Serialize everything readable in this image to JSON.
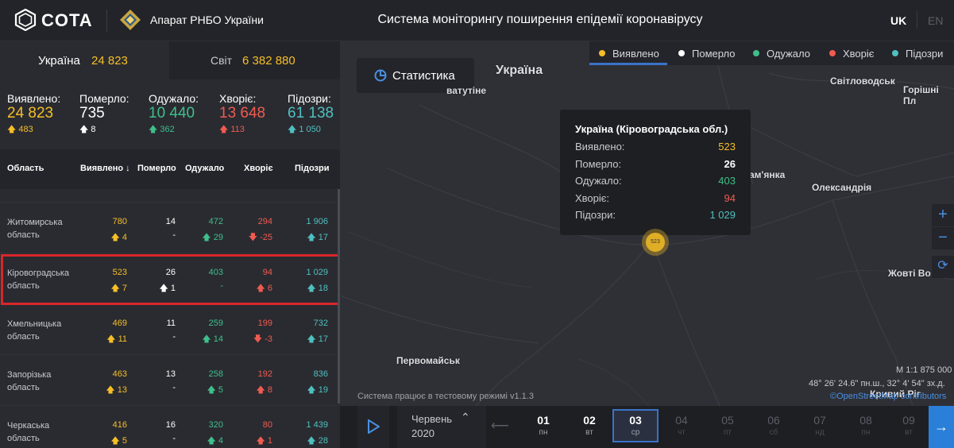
{
  "header": {
    "logo_text": "COTA",
    "org_name": "Апарат РНБО України",
    "title": "Система моніторингу поширення епідемії коронавірусу",
    "lang_uk": "UK",
    "lang_en": "EN"
  },
  "tabs": {
    "ukraine": {
      "label": "Україна",
      "value": "24 823"
    },
    "world": {
      "label": "Світ",
      "value": "6 382 880"
    }
  },
  "stats": [
    {
      "label": "Виявлено:",
      "value": "24 823",
      "delta": "483"
    },
    {
      "label": "Померло:",
      "value": "735",
      "delta": "8"
    },
    {
      "label": "Одужало:",
      "value": "10 440",
      "delta": "362"
    },
    {
      "label": "Хворіє:",
      "value": "13 648",
      "delta": "113"
    },
    {
      "label": "Підозри:",
      "value": "61 138",
      "delta": "1 050"
    }
  ],
  "table": {
    "headers": [
      "Область",
      "Виявлено ↓",
      "Померло",
      "Одужало",
      "Хворіє",
      "Підозри"
    ],
    "rows": [
      {
        "name1": "Житомирська",
        "name2": "область",
        "c1": "780",
        "d1": "4",
        "c2": "14",
        "d2": "-",
        "c3": "472",
        "d3": "29",
        "c4": "294",
        "d4": "-25",
        "c5": "1 906",
        "d5": "17"
      },
      {
        "name1": "Кіровоградська",
        "name2": "область",
        "c1": "523",
        "d1": "7",
        "c2": "26",
        "d2": "1",
        "c3": "403",
        "d3": "-",
        "c4": "94",
        "d4": "6",
        "c5": "1 029",
        "d5": "18"
      },
      {
        "name1": "Хмельницька",
        "name2": "область",
        "c1": "469",
        "d1": "11",
        "c2": "11",
        "d2": "-",
        "c3": "259",
        "d3": "14",
        "c4": "199",
        "d4": "-3",
        "c5": "732",
        "d5": "17"
      },
      {
        "name1": "Запорізька",
        "name2": "область",
        "c1": "463",
        "d1": "13",
        "c2": "13",
        "d2": "-",
        "c3": "258",
        "d3": "5",
        "c4": "192",
        "d4": "8",
        "c5": "836",
        "d5": "19"
      },
      {
        "name1": "Черкаська",
        "name2": "область",
        "c1": "416",
        "d1": "5",
        "c2": "16",
        "d2": "-",
        "c3": "320",
        "d3": "4",
        "c4": "80",
        "d4": "1",
        "c5": "1 439",
        "d5": "28"
      }
    ]
  },
  "map": {
    "stats_button": "Статистика",
    "legend": [
      "Виявлено",
      "Померло",
      "Одужало",
      "Хворіє",
      "Підозри"
    ],
    "cities": {
      "ukraine": "Україна",
      "vatutine": "ватутіне",
      "svitlovodsk": "Світловодськ",
      "horishni": "Горішні Пл",
      "znamianka": "ам'янка",
      "oleksandriia": "Олександрія",
      "zhovti": "Жовті Во",
      "pervomaisk": "Первомайськ",
      "kryvyi": "Кривий Ріг"
    },
    "tooltip": {
      "title": "Україна (Кіровоградська обл.)",
      "rows": [
        {
          "label": "Виявлено:",
          "value": "523"
        },
        {
          "label": "Померло:",
          "value": "26"
        },
        {
          "label": "Одужало:",
          "value": "403"
        },
        {
          "label": "Хворіє:",
          "value": "94"
        },
        {
          "label": "Підозри:",
          "value": "1 029"
        }
      ]
    },
    "marker_label": "523",
    "scale": "М 1:1 875 000",
    "coords": "48° 26' 24.6\" пн.ш., 32° 4' 54\" зх.д.",
    "osm": "©OpenStreetMap contributors",
    "test_mode": "Система працює в тестовому режимі v1.1.3"
  },
  "timeline": {
    "month": "Червень",
    "year": "2020",
    "days": [
      {
        "num": "01",
        "wd": "пн"
      },
      {
        "num": "02",
        "wd": "вт"
      },
      {
        "num": "03",
        "wd": "ср"
      },
      {
        "num": "04",
        "wd": "чт"
      },
      {
        "num": "05",
        "wd": "пт"
      },
      {
        "num": "06",
        "wd": "сб"
      },
      {
        "num": "07",
        "wd": "нд"
      },
      {
        "num": "08",
        "wd": "пн"
      },
      {
        "num": "09",
        "wd": "вт"
      }
    ]
  },
  "colors": {
    "detected": "#f6bf26",
    "dead": "#ffffff",
    "recovered": "#3fbf8a",
    "sick": "#f05b50",
    "suspected": "#4fc0c0",
    "accent": "#3a73c8",
    "highlight": "#d8262a"
  }
}
